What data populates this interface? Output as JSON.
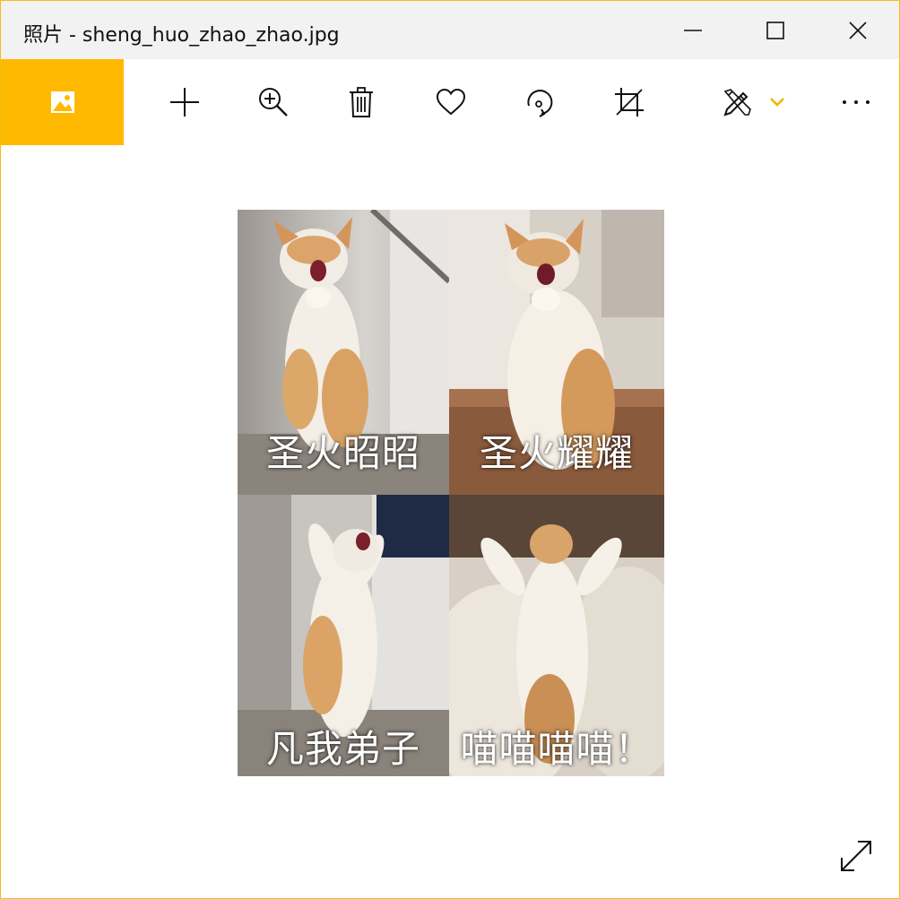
{
  "window": {
    "title": "照片 - sheng_huo_zhao_zhao.jpg",
    "accent_color": "#ffb900",
    "border_color": "#f2bd1b",
    "controls": [
      "minimize-icon",
      "maximize-icon",
      "close-icon"
    ]
  },
  "toolbar": {
    "buttons": [
      {
        "name": "view-home",
        "icon": "picture-icon"
      },
      {
        "name": "add-to",
        "icon": "plus-icon"
      },
      {
        "name": "zoom",
        "icon": "zoom-in-icon"
      },
      {
        "name": "delete",
        "icon": "trash-icon"
      },
      {
        "name": "favorite",
        "icon": "heart-icon"
      },
      {
        "name": "rotate",
        "icon": "rotate-icon"
      },
      {
        "name": "crop",
        "icon": "crop-icon"
      },
      {
        "name": "edit-create",
        "icon": "edit-pen-icon"
      },
      {
        "name": "edit-dropdown",
        "icon": "chevron-down-icon"
      },
      {
        "name": "more",
        "icon": "more-icon"
      }
    ]
  },
  "photo": {
    "captions": {
      "top_left": "圣火昭昭",
      "top_right": "圣火耀耀",
      "bottom_left": "凡我弟子",
      "bottom_right": "喵喵喵喵！"
    }
  },
  "fullscreen": {
    "icon": "expand-icon"
  }
}
